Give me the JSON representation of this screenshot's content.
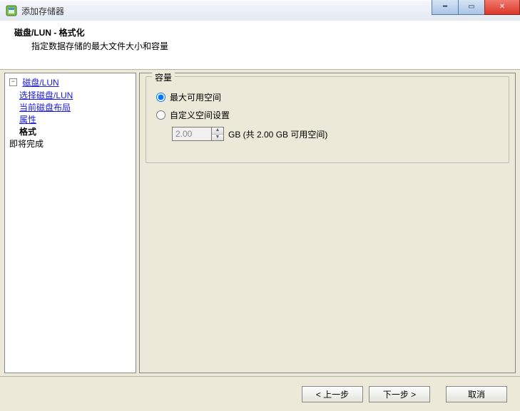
{
  "window": {
    "title": "添加存储器"
  },
  "header": {
    "title_main": "磁盘/LUN",
    "title_dash": " - ",
    "title_sub": "格式化",
    "description": "指定数据存储的最大文件大小和容量"
  },
  "nav": {
    "root": "磁盘/LUN",
    "items": {
      "select_disk": "选择磁盘/LUN",
      "current_layout": "当前磁盘布局",
      "properties": "属性",
      "format": "格式",
      "ready": "即将完成"
    }
  },
  "panel": {
    "group_title": "容量",
    "radio_max_label": "最大可用空间",
    "radio_custom_label": "自定义空间设置",
    "custom_value": "2.00",
    "custom_unit": "GB (共 2.00 GB 可用空间)"
  },
  "footer": {
    "back": "< 上一步",
    "next": "下一步 >",
    "cancel": "取消"
  }
}
